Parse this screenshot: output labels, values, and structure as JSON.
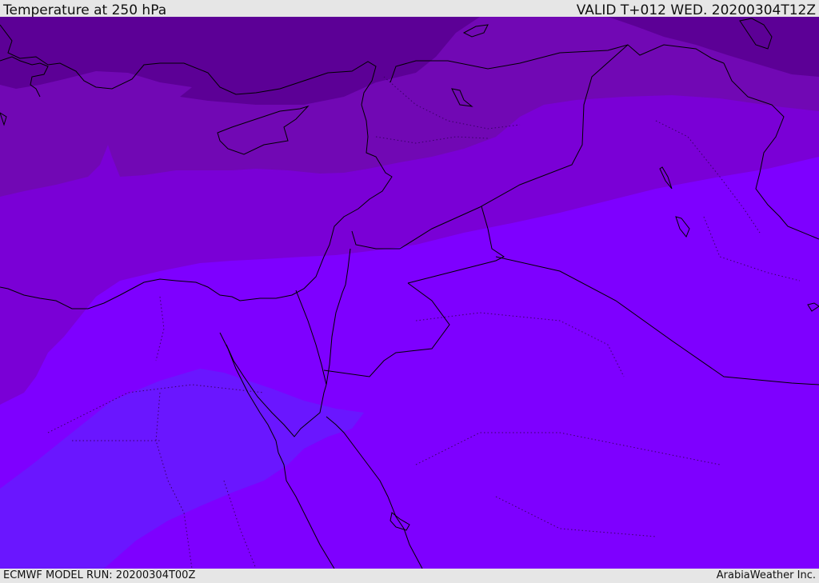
{
  "header": {
    "title": "Temperature at 250 hPa",
    "valid": "VALID T+012 WED. 20200304T12Z"
  },
  "footer": {
    "model_run": "ECMWF MODEL RUN: 20200304T00Z",
    "credit": "ArabiaWeather Inc."
  },
  "map": {
    "colors": {
      "band_darkest": "#5c0096",
      "band_dark": "#7108b4",
      "band_mid": "#7a00d6",
      "band_main": "#7e00ff",
      "band_cool": "#6a16ff",
      "coast_line": "#000000"
    }
  }
}
